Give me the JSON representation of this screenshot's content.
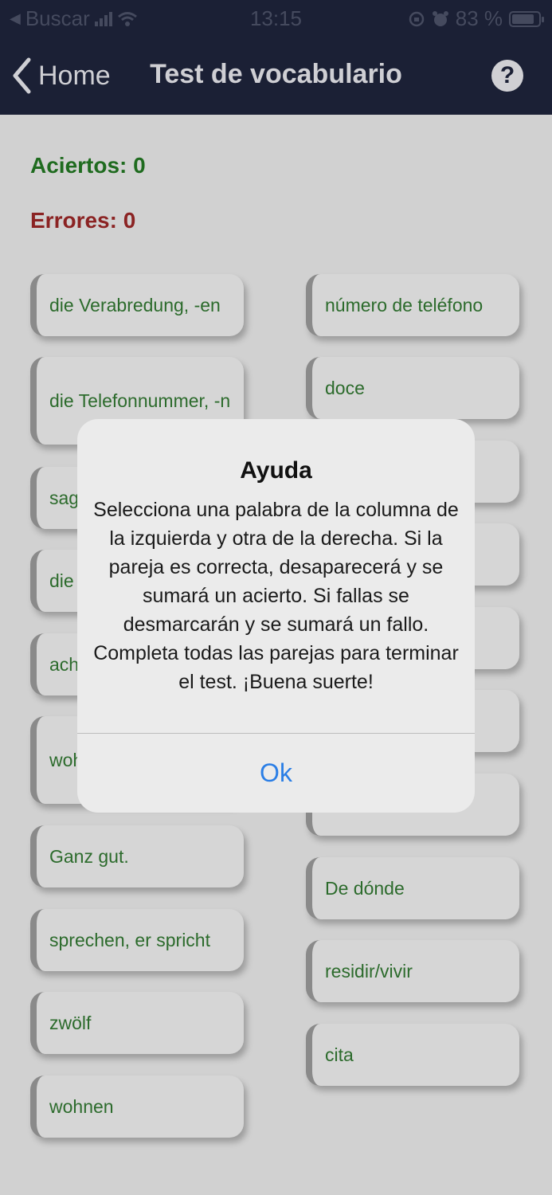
{
  "status_bar": {
    "back_app": "Buscar",
    "time": "13:15",
    "battery_text": "83 %",
    "battery_level": 0.83
  },
  "nav": {
    "back_label": "Home",
    "title": "Test de vocabulario"
  },
  "scores": {
    "hits": "Aciertos: 0",
    "errors": "Errores: 0"
  },
  "left_column": [
    "die Verabredung, -en",
    "die Telefonnummer, -n",
    "sagen",
    "die",
    "acht",
    "wohin kommen",
    "Ganz gut.",
    "sprechen, er spricht",
    "zwölf",
    "wohnen"
  ],
  "right_column": [
    "número de teléfono",
    "doce",
    "",
    "",
    "",
    "",
    "",
    "De dónde",
    "residir/vivir",
    "cita"
  ],
  "alert": {
    "title": "Ayuda",
    "message": "Selecciona una palabra de la columna de la izquierda y otra de la derecha. Si la pareja es correcta, desaparecerá y se sumará un acierto. Si fallas se desmarcarán y se sumará un fallo. Completa todas las parejas para terminar el test. ¡Buena suerte!",
    "ok_label": "Ok"
  },
  "colors": {
    "nav_bg": "#1b2035",
    "hits": "#1f6b1f",
    "errors": "#8b2323",
    "card_text": "#2c6b2c",
    "ok_button": "#2a7ee6"
  }
}
